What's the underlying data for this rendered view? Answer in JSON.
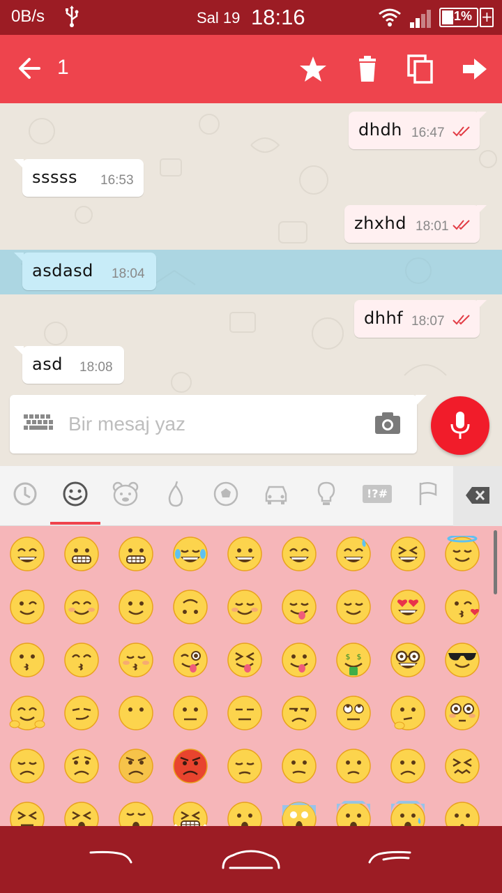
{
  "status_bar": {
    "speed": "0B/s",
    "date": "Sal 19",
    "time": "18:16",
    "battery": "31%",
    "icons": [
      "usb-icon",
      "wifi-icon",
      "signal-icon",
      "battery-icon",
      "charging-icon"
    ]
  },
  "app_bar": {
    "selected_count": "1",
    "actions": [
      "back-arrow-icon",
      "star-icon",
      "delete-icon",
      "copy-icon",
      "forward-icon"
    ]
  },
  "messages": [
    {
      "dir": "out",
      "text": "dhdh",
      "time": "16:47",
      "read": true
    },
    {
      "dir": "in",
      "text": "sssss",
      "time": "16:53"
    },
    {
      "dir": "out",
      "text": "zhxhd",
      "time": "18:01",
      "read": true
    },
    {
      "dir": "in",
      "text": "asdasd",
      "time": "18:04",
      "selected": true
    },
    {
      "dir": "out",
      "text": "dhhf",
      "time": "18:07",
      "read": true
    },
    {
      "dir": "in",
      "text": "asd",
      "time": "18:08"
    }
  ],
  "composer": {
    "placeholder": "Bir mesaj yaz",
    "icons": [
      "keyboard-icon",
      "camera-icon",
      "microphone-icon"
    ]
  },
  "emoji_tabs": {
    "tabs": [
      "recent",
      "smileys",
      "animals",
      "food",
      "sports",
      "travel",
      "objects",
      "symbols",
      "flags"
    ],
    "symbols_label": "!?#",
    "active": "smileys"
  },
  "colors": {
    "status_bar": "#9c1c24",
    "app_bar": "#ee444d",
    "mic_button": "#f11c2a",
    "emoji_panel": "#f6b6b9"
  },
  "emoji_grid": [
    [
      "grinning",
      "grimacing",
      "grimacing",
      "joy",
      "smiley",
      "smile",
      "sweat-smile",
      "laughing",
      "innocent"
    ],
    [
      "wink",
      "blush",
      "slight-smile",
      "upside-down",
      "relaxed",
      "yum",
      "relieved",
      "heart-eyes",
      "kissing-heart"
    ],
    [
      "kissing",
      "kissing-smiling-eyes",
      "kissing-closed-eyes",
      "tongue-wink",
      "tongue-closed-eyes",
      "tongue",
      "money-mouth",
      "nerd",
      "sunglasses"
    ],
    [
      "hugging",
      "smirk",
      "no-mouth",
      "neutral",
      "expressionless",
      "unamused",
      "rolling-eyes",
      "thinking",
      "flushed"
    ],
    [
      "disappointed",
      "worried",
      "angry",
      "rage",
      "pensive",
      "confused",
      "slight-frown",
      "frowning",
      "confounded"
    ],
    [
      "persevere",
      "tired",
      "weary",
      "triumph",
      "open-mouth",
      "scream",
      "fearful",
      "cold-sweat",
      "hushed"
    ]
  ]
}
